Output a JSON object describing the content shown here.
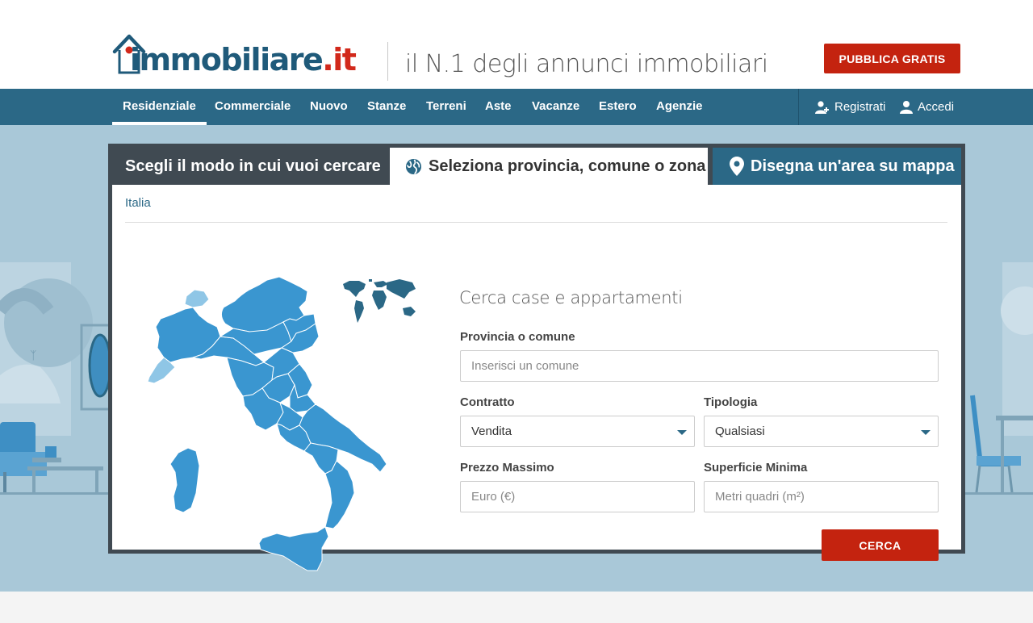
{
  "brand": {
    "logo_main": "immobiliare",
    "logo_tld": ".it",
    "tagline": "il N.1 degli annunci immobiliari",
    "publish_label": "PUBBLICA GRATIS",
    "accent_color": "#c4230f",
    "primary_color": "#2b6886"
  },
  "nav": {
    "items": [
      {
        "label": "Residenziale",
        "active": true
      },
      {
        "label": "Commerciale"
      },
      {
        "label": "Nuovo"
      },
      {
        "label": "Stanze"
      },
      {
        "label": "Terreni"
      },
      {
        "label": "Aste"
      },
      {
        "label": "Vacanze"
      },
      {
        "label": "Estero"
      },
      {
        "label": "Agenzie"
      }
    ],
    "register_label": "Registrati",
    "register_icon": "user-plus-icon",
    "login_label": "Accedi",
    "login_icon": "user-icon"
  },
  "search": {
    "tabs_title": "Scegli il modo in cui vuoi cercare",
    "tab_region": "Seleziona provincia, comune o zona",
    "tab_region_icon": "globe-icon",
    "tab_map": "Disegna un'area su mappa",
    "tab_map_icon": "map-pin-icon",
    "breadcrumb": "Italia",
    "form_title": "Cerca case e appartamenti",
    "province_label": "Provincia o comune",
    "province_placeholder": "Inserisci un comune",
    "contract_label": "Contratto",
    "contract_value": "Vendita",
    "type_label": "Tipologia",
    "type_value": "Qualsiasi",
    "price_label": "Prezzo Massimo",
    "price_placeholder": "Euro (€)",
    "area_label": "Superficie Minima",
    "area_placeholder": "Metri quadri (m²)",
    "submit_label": "CERCA"
  }
}
